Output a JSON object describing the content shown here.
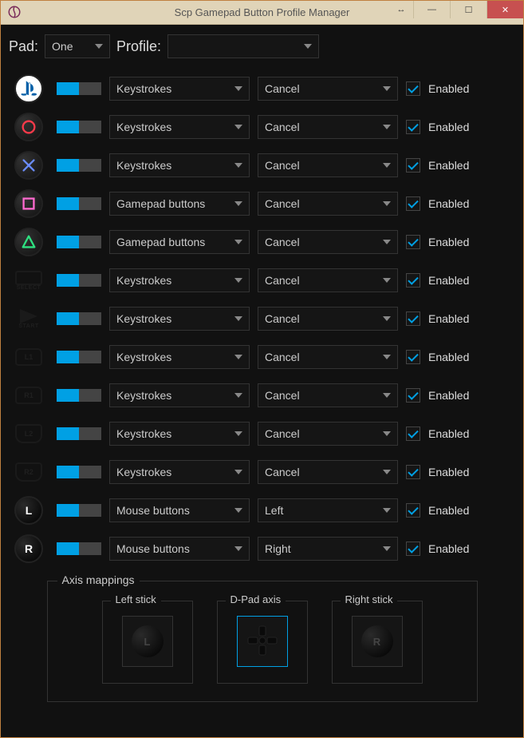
{
  "window": {
    "title": "Scp Gamepad Button Profile Manager"
  },
  "topbar": {
    "pad_label": "Pad:",
    "pad_value": "One",
    "profile_label": "Profile:",
    "profile_value": ""
  },
  "enabled_label": "Enabled",
  "rows": [
    {
      "icon": "ps",
      "type": "Keystrokes",
      "action": "Cancel",
      "enabled": true
    },
    {
      "icon": "circle",
      "type": "Keystrokes",
      "action": "Cancel",
      "enabled": true
    },
    {
      "icon": "cross",
      "type": "Keystrokes",
      "action": "Cancel",
      "enabled": true
    },
    {
      "icon": "square",
      "type": "Gamepad buttons",
      "action": "Cancel",
      "enabled": true
    },
    {
      "icon": "triangle",
      "type": "Gamepad buttons",
      "action": "Cancel",
      "enabled": true
    },
    {
      "icon": "select",
      "type": "Keystrokes",
      "action": "Cancel",
      "enabled": true
    },
    {
      "icon": "start",
      "type": "Keystrokes",
      "action": "Cancel",
      "enabled": true
    },
    {
      "icon": "l1",
      "type": "Keystrokes",
      "action": "Cancel",
      "enabled": true
    },
    {
      "icon": "r1",
      "type": "Keystrokes",
      "action": "Cancel",
      "enabled": true
    },
    {
      "icon": "l2",
      "type": "Keystrokes",
      "action": "Cancel",
      "enabled": true
    },
    {
      "icon": "r2",
      "type": "Keystrokes",
      "action": "Cancel",
      "enabled": true
    },
    {
      "icon": "l3",
      "type": "Mouse buttons",
      "action": "Left",
      "enabled": true
    },
    {
      "icon": "r3",
      "type": "Mouse buttons",
      "action": "Right",
      "enabled": true
    }
  ],
  "axis": {
    "group_label": "Axis mappings",
    "left_label": "Left stick",
    "dpad_label": "D-Pad axis",
    "right_label": "Right stick",
    "selected": "dpad"
  }
}
